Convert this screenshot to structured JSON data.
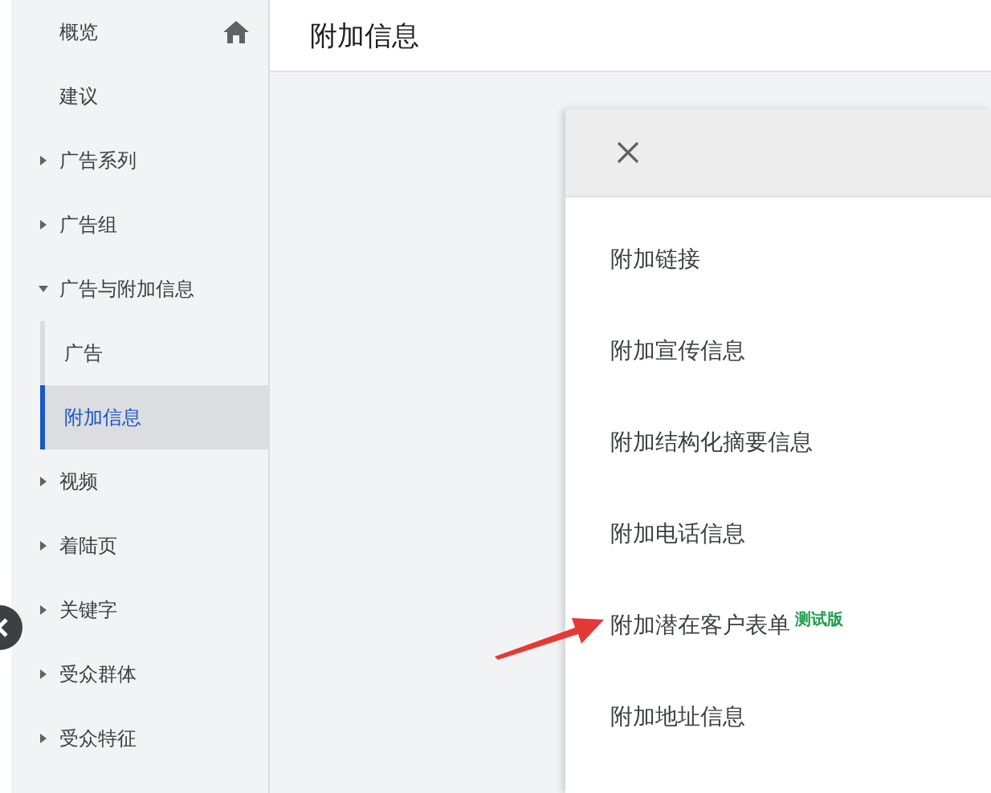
{
  "sidebar": {
    "items": [
      {
        "label": "概览",
        "kind": "home"
      },
      {
        "label": "建议",
        "kind": "plain"
      },
      {
        "label": "广告系列",
        "kind": "group",
        "expanded": false
      },
      {
        "label": "广告组",
        "kind": "group",
        "expanded": false
      },
      {
        "label": "广告与附加信息",
        "kind": "group",
        "expanded": true,
        "children": [
          {
            "label": "广告",
            "selected": false
          },
          {
            "label": "附加信息",
            "selected": true
          }
        ]
      },
      {
        "label": "视频",
        "kind": "group",
        "expanded": false
      },
      {
        "label": "着陆页",
        "kind": "group",
        "expanded": false
      },
      {
        "label": "关键字",
        "kind": "group",
        "expanded": false
      },
      {
        "label": "受众群体",
        "kind": "group",
        "expanded": false
      },
      {
        "label": "受众特征",
        "kind": "group",
        "expanded": false
      }
    ]
  },
  "header": {
    "title": "附加信息"
  },
  "panel": {
    "items": [
      {
        "label": "附加链接"
      },
      {
        "label": "附加宣传信息"
      },
      {
        "label": "附加结构化摘要信息"
      },
      {
        "label": "附加电话信息"
      },
      {
        "label": "附加潜在客户表单",
        "badge": "测试版"
      },
      {
        "label": "附加地址信息"
      }
    ]
  }
}
